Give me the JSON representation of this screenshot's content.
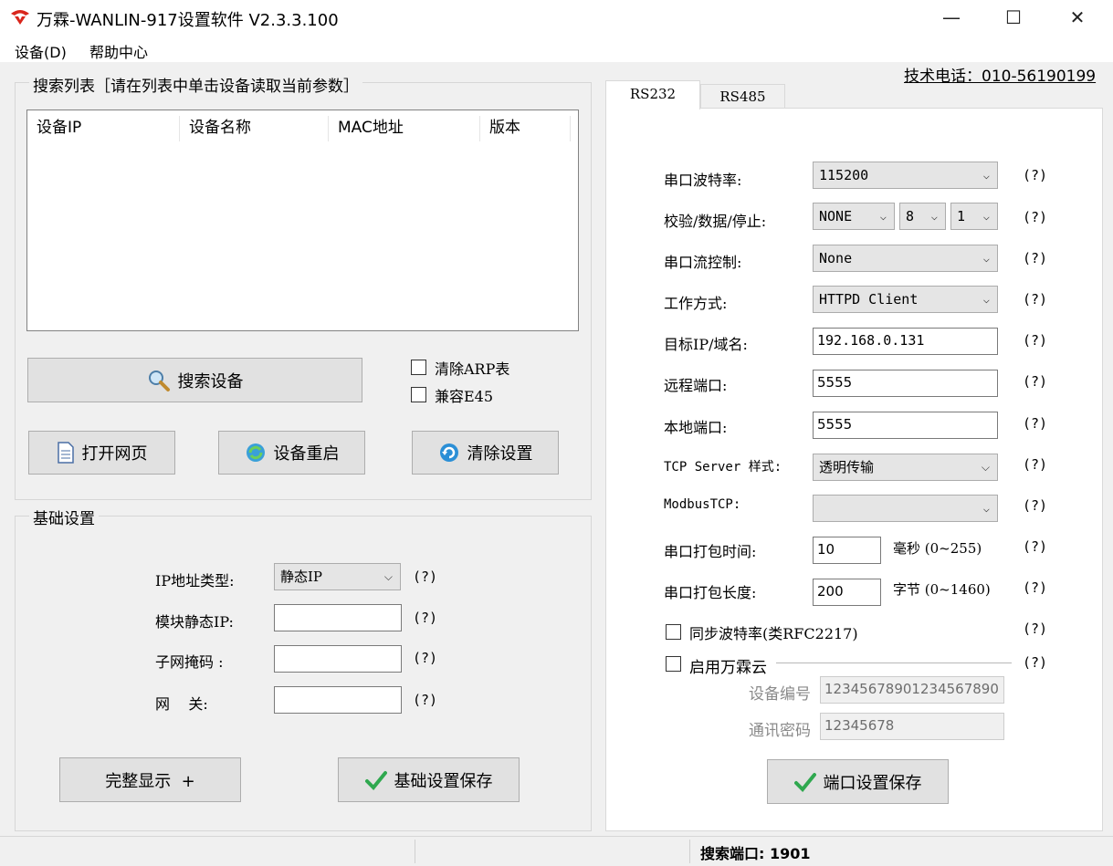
{
  "window": {
    "title": "万霖-WANLIN-917设置软件 V2.3.3.100",
    "minimize": "—",
    "maximize": "☐",
    "close": "✕"
  },
  "menu": {
    "device": "设备(D)",
    "help": "帮助中心"
  },
  "phone": "技术电话：010-56190199",
  "search": {
    "group_title": "搜索列表［请在列表中单击设备读取当前参数］",
    "columns": [
      "设备IP",
      "设备名称",
      "MAC地址",
      "版本"
    ],
    "rows": [],
    "search_button": "搜索设备",
    "clear_arp": "清除ARP表",
    "compat_e45": "兼容E45",
    "open_web": "打开网页",
    "restart": "设备重启",
    "clear_settings": "清除设置"
  },
  "basic": {
    "group_title": "基础设置",
    "ip_type_label": "IP地址类型:",
    "ip_type_value": "静态IP",
    "static_ip_label": "模块静态IP:",
    "static_ip_value": "",
    "subnet_label": "子网掩码 :",
    "subnet_value": "",
    "gateway_label": "网    关:",
    "gateway_value": "",
    "help": "(?)",
    "full_display": "完整显示  +",
    "save": "基础设置保存"
  },
  "tabs": [
    "RS232",
    "RS485"
  ],
  "rs232": {
    "baud_label": "串口波特率:",
    "baud_value": "115200",
    "parity_label": "校验/数据/停止:",
    "parity_value": "NONE",
    "data_bits": "8",
    "stop_bits": "1",
    "flow_label": "串口流控制:",
    "flow_value": "None",
    "mode_label": "工作方式:",
    "mode_value": "HTTPD Client",
    "target_label": "目标IP/域名:",
    "target_value": "192.168.0.131",
    "remote_port_label": "远程端口:",
    "remote_port_value": "5555",
    "local_port_label": "本地端口:",
    "local_port_value": "5555",
    "tcp_style_label": "TCP Server 样式:",
    "tcp_style_value": "透明传输",
    "modbus_label": "ModbusTCP:",
    "modbus_value": "",
    "pack_time_label": "串口打包时间:",
    "pack_time_value": "10",
    "pack_time_unit": "毫秒 (0~255)",
    "pack_len_label": "串口打包长度:",
    "pack_len_value": "200",
    "pack_len_unit": "字节 (0~1460)",
    "sync_baud": "同步波特率(类RFC2217)",
    "cloud_enable": "启用万霖云",
    "device_no_label": "设备编号",
    "device_no_value": "12345678901234567890",
    "comm_pwd_label": "通讯密码",
    "comm_pwd_value": "12345678",
    "save": "端口设置保存",
    "help": "(?)"
  },
  "status": {
    "search_port": "搜索端口: 1901"
  },
  "colors": {
    "accent_red": "#d9261c",
    "check_green": "#2fa84f",
    "tab_active_bg": "#ffffff"
  }
}
